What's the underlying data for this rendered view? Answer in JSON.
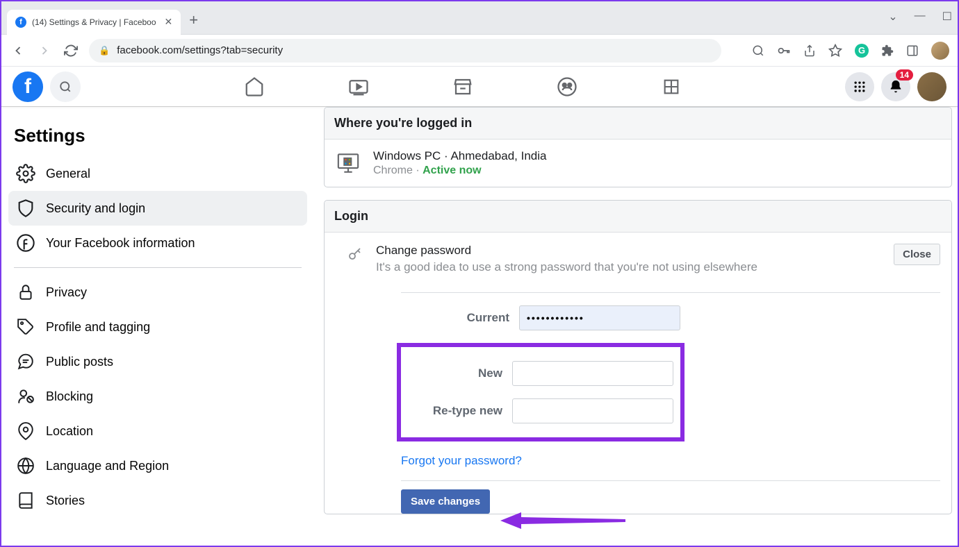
{
  "browser": {
    "tab_title": "(14) Settings & Privacy | Faceboo",
    "url": "facebook.com/settings?tab=security"
  },
  "fb_header": {
    "notif_badge": "14"
  },
  "sidebar": {
    "title": "Settings",
    "items": [
      {
        "label": "General",
        "icon": "gear"
      },
      {
        "label": "Security and login",
        "icon": "shield"
      },
      {
        "label": "Your Facebook information",
        "icon": "fb-circle"
      },
      {
        "label": "Privacy",
        "icon": "lock"
      },
      {
        "label": "Profile and tagging",
        "icon": "tag"
      },
      {
        "label": "Public posts",
        "icon": "comment"
      },
      {
        "label": "Blocking",
        "icon": "user-block"
      },
      {
        "label": "Location",
        "icon": "pin"
      },
      {
        "label": "Language and Region",
        "icon": "globe"
      },
      {
        "label": "Stories",
        "icon": "book"
      }
    ]
  },
  "sections": {
    "logged_in_header": "Where you're logged in",
    "session_device": "Windows PC · Ahmedabad, India",
    "session_browser": "Chrome · ",
    "session_active": "Active now",
    "login_header": "Login",
    "change_password_title": "Change password",
    "change_password_desc": "It's a good idea to use a strong password that you're not using elsewhere",
    "close_label": "Close",
    "current_label": "Current",
    "current_value": "••••••••••••",
    "new_label": "New",
    "retype_label": "Re-type new",
    "forgot_link": "Forgot your password?",
    "save_label": "Save changes"
  }
}
